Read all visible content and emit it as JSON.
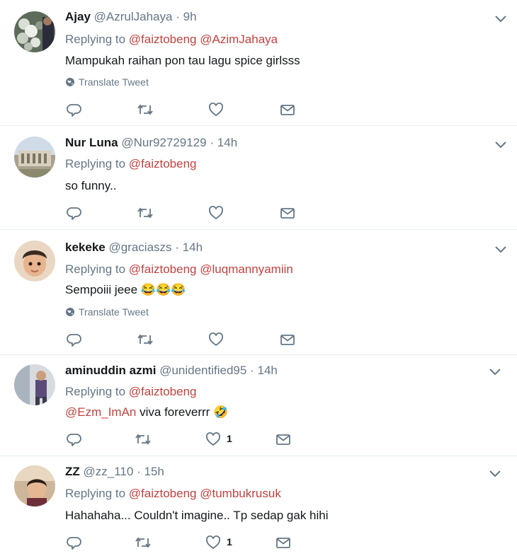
{
  "ui": {
    "replying_to": "Replying to",
    "translate": "Translate Tweet"
  },
  "tweets": [
    {
      "name": "Ajay",
      "handle": "@AzrulJahaya",
      "time": "9h",
      "mentions": [
        "@faiztobeng",
        "@AzimJahaya"
      ],
      "text": "Mampukah raihan pon tau lagu spice girlsss",
      "translate": true,
      "likes": ""
    },
    {
      "name": "Nur Luna",
      "handle": "@Nur92729129",
      "time": "14h",
      "mentions": [
        "@faiztobeng"
      ],
      "text": "so funny..",
      "translate": false,
      "likes": ""
    },
    {
      "name": "kekeke",
      "handle": "@graciaszs",
      "time": "14h",
      "mentions": [
        "@faiztobeng",
        "@luqmannyamiin"
      ],
      "text": "Sempoiii jeee",
      "emoji": "😂😂😂",
      "translate": true,
      "likes": ""
    },
    {
      "name": "aminuddin azmi",
      "handle": "@unidentified95",
      "time": "14h",
      "mentions": [
        "@faiztobeng"
      ],
      "text_mention": "@Ezm_ImAn",
      "text": "viva foreverrr",
      "emoji": "🤣",
      "translate": false,
      "likes": "1"
    },
    {
      "name": "ZZ",
      "handle": "@zz_110",
      "time": "15h",
      "mentions": [
        "@faiztobeng",
        "@tumbukrusuk"
      ],
      "text": "Hahahaha... Couldn't imagine.. Tp sedap gak hihi",
      "translate": false,
      "likes": "1"
    }
  ]
}
